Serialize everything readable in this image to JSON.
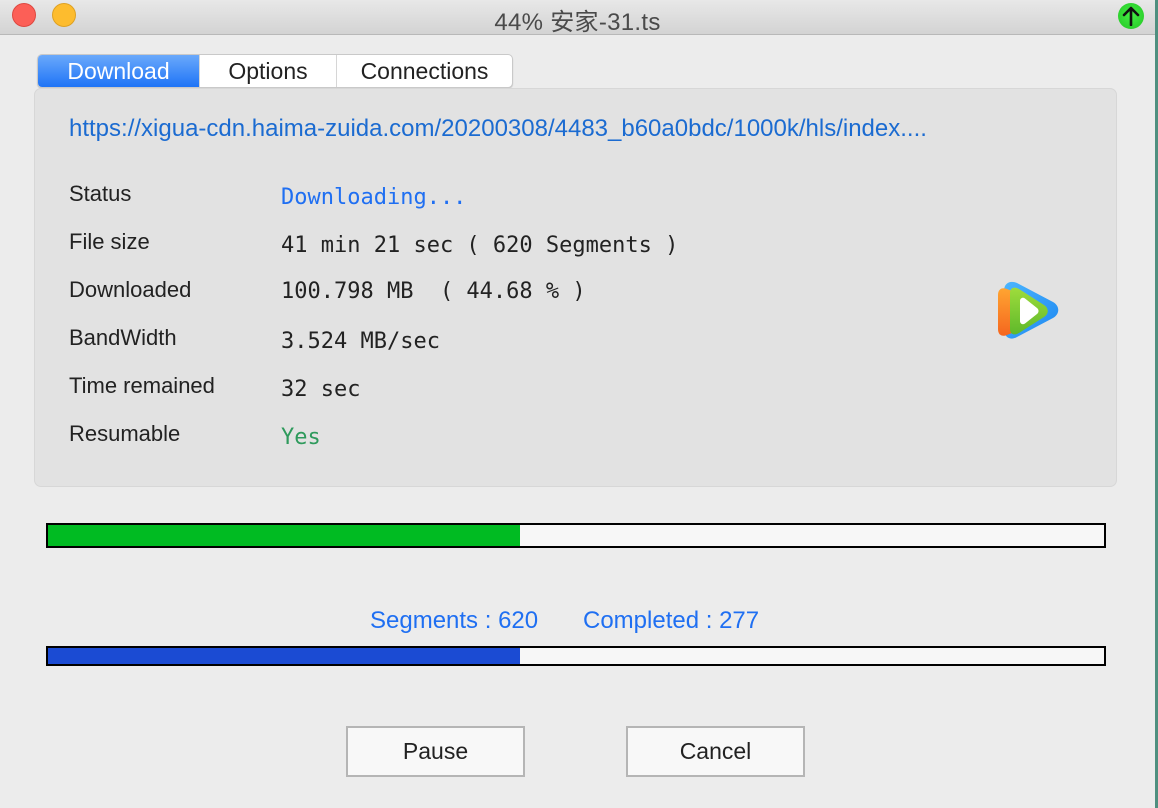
{
  "window": {
    "title": "44%  安家-31.ts",
    "status_indicator_icon": "green-up-arrow-icon"
  },
  "tabs": [
    {
      "label": "Download",
      "active": true
    },
    {
      "label": "Options",
      "active": false
    },
    {
      "label": "Connections",
      "active": false
    }
  ],
  "details": {
    "url": "https://xigua-cdn.haima-zuida.com/20200308/4483_b60a0bdc/1000k/hls/index....",
    "rows": [
      {
        "label": "Status",
        "value": "Downloading..."
      },
      {
        "label": "File size",
        "value": "41 min 21 sec ( 620 Segments )"
      },
      {
        "label": "Downloaded",
        "value": "100.798 MB  ( 44.68 % )"
      },
      {
        "label": "BandWidth",
        "value": "3.524 MB/sec"
      },
      {
        "label": "Time remained",
        "value": "32 sec"
      },
      {
        "label": "Resumable",
        "value": "Yes"
      }
    ],
    "app_icon": "tencent-video-logo-icon"
  },
  "progress": {
    "file_percent": 44.68,
    "segments_label": "Segments : 620",
    "completed_label": "Completed : 277",
    "segments_total": 620,
    "segments_completed": 277
  },
  "buttons": {
    "pause": "Pause",
    "cancel": "Cancel"
  },
  "colors": {
    "accent_blue": "#1f6ff2",
    "file_progress": "#00bb22",
    "segment_progress": "#1b4bd3",
    "resumable_yes": "#2e9a5c"
  }
}
